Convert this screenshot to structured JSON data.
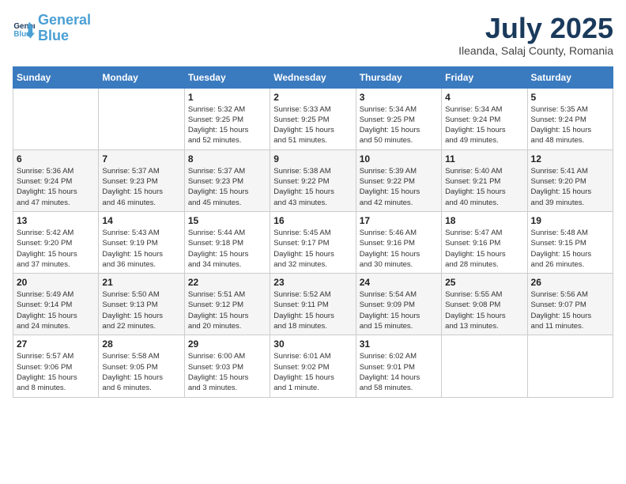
{
  "logo": {
    "line1": "General",
    "line2": "Blue"
  },
  "title": "July 2025",
  "subtitle": "Ileanda, Salaj County, Romania",
  "days_of_week": [
    "Sunday",
    "Monday",
    "Tuesday",
    "Wednesday",
    "Thursday",
    "Friday",
    "Saturday"
  ],
  "weeks": [
    [
      {
        "day": "",
        "info": ""
      },
      {
        "day": "",
        "info": ""
      },
      {
        "day": "1",
        "info": "Sunrise: 5:32 AM\nSunset: 9:25 PM\nDaylight: 15 hours\nand 52 minutes."
      },
      {
        "day": "2",
        "info": "Sunrise: 5:33 AM\nSunset: 9:25 PM\nDaylight: 15 hours\nand 51 minutes."
      },
      {
        "day": "3",
        "info": "Sunrise: 5:34 AM\nSunset: 9:25 PM\nDaylight: 15 hours\nand 50 minutes."
      },
      {
        "day": "4",
        "info": "Sunrise: 5:34 AM\nSunset: 9:24 PM\nDaylight: 15 hours\nand 49 minutes."
      },
      {
        "day": "5",
        "info": "Sunrise: 5:35 AM\nSunset: 9:24 PM\nDaylight: 15 hours\nand 48 minutes."
      }
    ],
    [
      {
        "day": "6",
        "info": "Sunrise: 5:36 AM\nSunset: 9:24 PM\nDaylight: 15 hours\nand 47 minutes."
      },
      {
        "day": "7",
        "info": "Sunrise: 5:37 AM\nSunset: 9:23 PM\nDaylight: 15 hours\nand 46 minutes."
      },
      {
        "day": "8",
        "info": "Sunrise: 5:37 AM\nSunset: 9:23 PM\nDaylight: 15 hours\nand 45 minutes."
      },
      {
        "day": "9",
        "info": "Sunrise: 5:38 AM\nSunset: 9:22 PM\nDaylight: 15 hours\nand 43 minutes."
      },
      {
        "day": "10",
        "info": "Sunrise: 5:39 AM\nSunset: 9:22 PM\nDaylight: 15 hours\nand 42 minutes."
      },
      {
        "day": "11",
        "info": "Sunrise: 5:40 AM\nSunset: 9:21 PM\nDaylight: 15 hours\nand 40 minutes."
      },
      {
        "day": "12",
        "info": "Sunrise: 5:41 AM\nSunset: 9:20 PM\nDaylight: 15 hours\nand 39 minutes."
      }
    ],
    [
      {
        "day": "13",
        "info": "Sunrise: 5:42 AM\nSunset: 9:20 PM\nDaylight: 15 hours\nand 37 minutes."
      },
      {
        "day": "14",
        "info": "Sunrise: 5:43 AM\nSunset: 9:19 PM\nDaylight: 15 hours\nand 36 minutes."
      },
      {
        "day": "15",
        "info": "Sunrise: 5:44 AM\nSunset: 9:18 PM\nDaylight: 15 hours\nand 34 minutes."
      },
      {
        "day": "16",
        "info": "Sunrise: 5:45 AM\nSunset: 9:17 PM\nDaylight: 15 hours\nand 32 minutes."
      },
      {
        "day": "17",
        "info": "Sunrise: 5:46 AM\nSunset: 9:16 PM\nDaylight: 15 hours\nand 30 minutes."
      },
      {
        "day": "18",
        "info": "Sunrise: 5:47 AM\nSunset: 9:16 PM\nDaylight: 15 hours\nand 28 minutes."
      },
      {
        "day": "19",
        "info": "Sunrise: 5:48 AM\nSunset: 9:15 PM\nDaylight: 15 hours\nand 26 minutes."
      }
    ],
    [
      {
        "day": "20",
        "info": "Sunrise: 5:49 AM\nSunset: 9:14 PM\nDaylight: 15 hours\nand 24 minutes."
      },
      {
        "day": "21",
        "info": "Sunrise: 5:50 AM\nSunset: 9:13 PM\nDaylight: 15 hours\nand 22 minutes."
      },
      {
        "day": "22",
        "info": "Sunrise: 5:51 AM\nSunset: 9:12 PM\nDaylight: 15 hours\nand 20 minutes."
      },
      {
        "day": "23",
        "info": "Sunrise: 5:52 AM\nSunset: 9:11 PM\nDaylight: 15 hours\nand 18 minutes."
      },
      {
        "day": "24",
        "info": "Sunrise: 5:54 AM\nSunset: 9:09 PM\nDaylight: 15 hours\nand 15 minutes."
      },
      {
        "day": "25",
        "info": "Sunrise: 5:55 AM\nSunset: 9:08 PM\nDaylight: 15 hours\nand 13 minutes."
      },
      {
        "day": "26",
        "info": "Sunrise: 5:56 AM\nSunset: 9:07 PM\nDaylight: 15 hours\nand 11 minutes."
      }
    ],
    [
      {
        "day": "27",
        "info": "Sunrise: 5:57 AM\nSunset: 9:06 PM\nDaylight: 15 hours\nand 8 minutes."
      },
      {
        "day": "28",
        "info": "Sunrise: 5:58 AM\nSunset: 9:05 PM\nDaylight: 15 hours\nand 6 minutes."
      },
      {
        "day": "29",
        "info": "Sunrise: 6:00 AM\nSunset: 9:03 PM\nDaylight: 15 hours\nand 3 minutes."
      },
      {
        "day": "30",
        "info": "Sunrise: 6:01 AM\nSunset: 9:02 PM\nDaylight: 15 hours\nand 1 minute."
      },
      {
        "day": "31",
        "info": "Sunrise: 6:02 AM\nSunset: 9:01 PM\nDaylight: 14 hours\nand 58 minutes."
      },
      {
        "day": "",
        "info": ""
      },
      {
        "day": "",
        "info": ""
      }
    ]
  ]
}
